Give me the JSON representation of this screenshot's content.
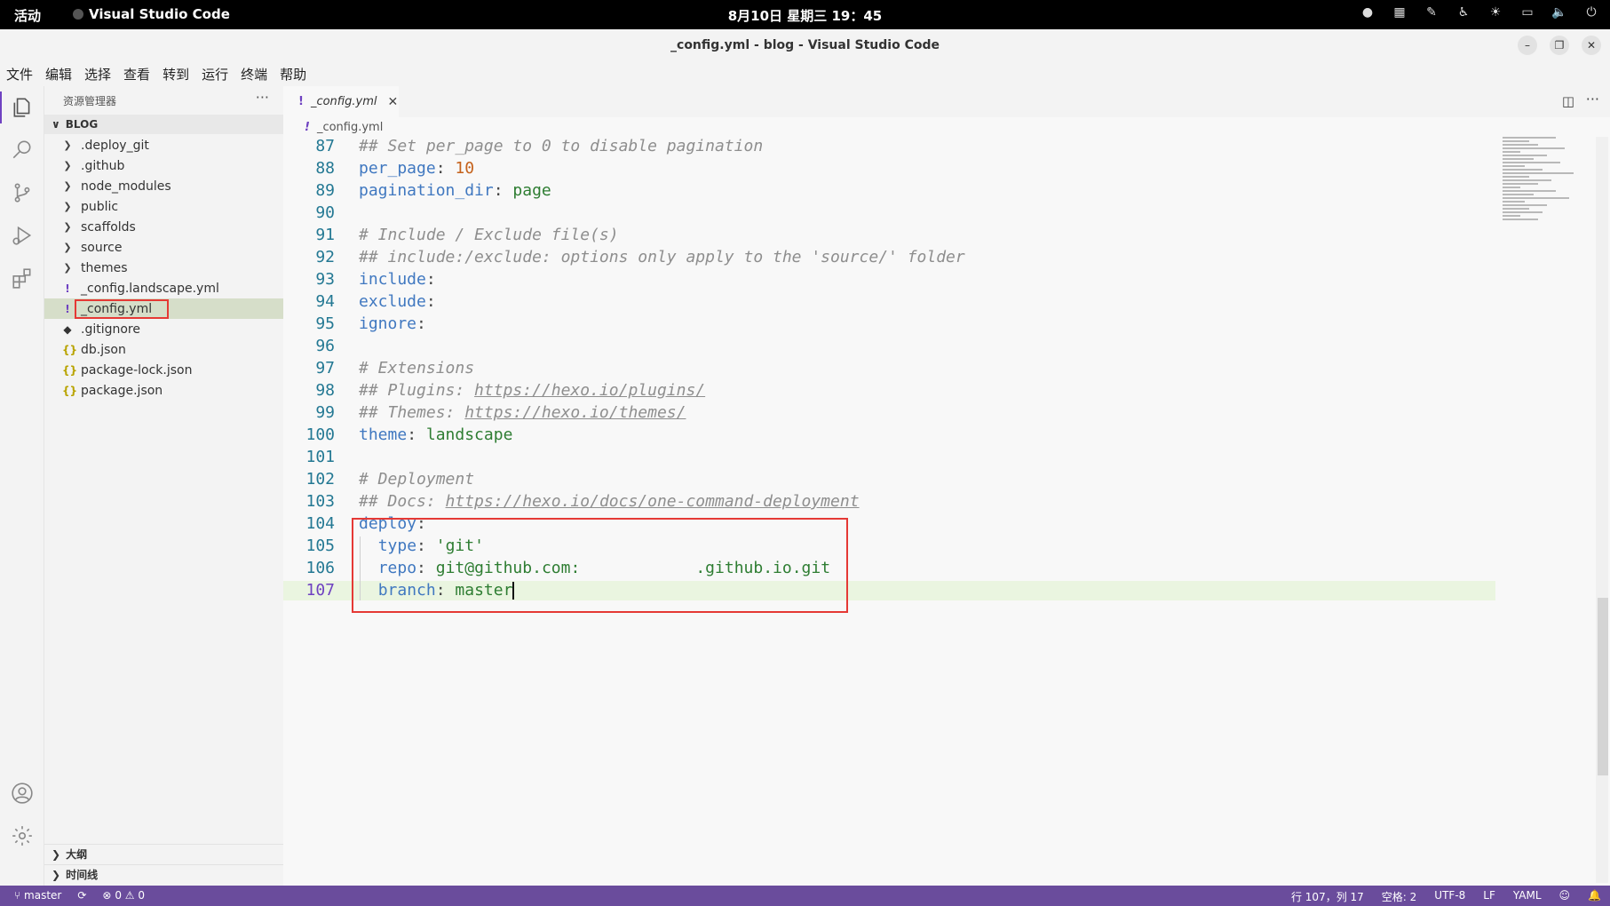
{
  "topbar": {
    "activities": "活动",
    "app_name": "Visual Studio Code",
    "clock": "8月10日 星期三 19：45"
  },
  "window": {
    "title": "_config.yml - blog - Visual Studio Code"
  },
  "menu": [
    "文件",
    "编辑",
    "选择",
    "查看",
    "转到",
    "运行",
    "终端",
    "帮助"
  ],
  "sidebar": {
    "title": "资源管理器",
    "section": "BLOG",
    "items": [
      {
        "label": ".deploy_git",
        "type": "folder"
      },
      {
        "label": ".github",
        "type": "folder"
      },
      {
        "label": "node_modules",
        "type": "folder"
      },
      {
        "label": "public",
        "type": "folder"
      },
      {
        "label": "scaffolds",
        "type": "folder"
      },
      {
        "label": "source",
        "type": "folder"
      },
      {
        "label": "themes",
        "type": "folder"
      },
      {
        "label": "_config.landscape.yml",
        "type": "yaml"
      },
      {
        "label": "_config.yml",
        "type": "yaml",
        "selected": true
      },
      {
        "label": ".gitignore",
        "type": "git"
      },
      {
        "label": "db.json",
        "type": "json"
      },
      {
        "label": "package-lock.json",
        "type": "json"
      },
      {
        "label": "package.json",
        "type": "json"
      }
    ],
    "outline": "大纲",
    "timeline": "时间线"
  },
  "editor": {
    "tab_label": "_config.yml",
    "breadcrumb": "_config.yml",
    "lines": [
      {
        "n": "87"
      },
      {
        "n": "88"
      },
      {
        "n": "89"
      },
      {
        "n": "90"
      },
      {
        "n": "91"
      },
      {
        "n": "92"
      },
      {
        "n": "93"
      },
      {
        "n": "94"
      },
      {
        "n": "95"
      },
      {
        "n": "96"
      },
      {
        "n": "97"
      },
      {
        "n": "98"
      },
      {
        "n": "99"
      },
      {
        "n": "100"
      },
      {
        "n": "101"
      },
      {
        "n": "102"
      },
      {
        "n": "103"
      },
      {
        "n": "104"
      },
      {
        "n": "105"
      },
      {
        "n": "106"
      },
      {
        "n": "107"
      }
    ],
    "code": {
      "l87": "## Set per_page to 0 to disable pagination",
      "l88_key": "per_page",
      "l88_val": "10",
      "l89_key": "pagination_dir",
      "l89_val": "page",
      "l91": "# Include / Exclude file(s)",
      "l92": "## include:/exclude: options only apply to the 'source/' folder",
      "l93_key": "include",
      "l94_key": "exclude",
      "l95_key": "ignore",
      "l97": "# Extensions",
      "l98_pre": "## Plugins: ",
      "l98_url": "https://hexo.io/plugins/",
      "l99_pre": "## Themes: ",
      "l99_url": "https://hexo.io/themes/",
      "l100_key": "theme",
      "l100_val": "landscape",
      "l102": "# Deployment",
      "l103_pre": "## Docs: ",
      "l103_url": "https://hexo.io/docs/one-command-deployment",
      "l104_key": "deploy",
      "l105_key": "type",
      "l105_val": "'git'",
      "l106_key": "repo",
      "l106_val_a": "git@github.com:",
      "l106_val_b": ".github.io.git",
      "l107_key": "branch",
      "l107_val": "master"
    }
  },
  "status": {
    "branch": "master",
    "problems": "0",
    "warnings": "0",
    "position": "行 107，列 17",
    "spaces": "空格: 2",
    "encoding": "UTF-8",
    "eol": "LF",
    "language": "YAML"
  }
}
